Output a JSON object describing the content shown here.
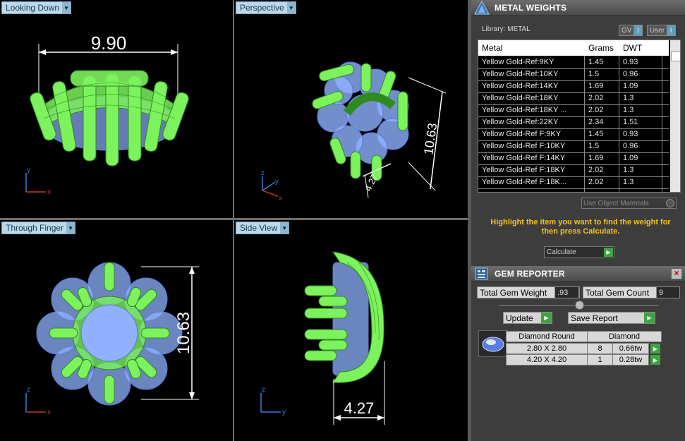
{
  "viewports": {
    "looking_down": {
      "label": "Looking Down",
      "dimension": "9.90",
      "axis_a": "y",
      "axis_b": "x"
    },
    "perspective": {
      "label": "Perspective",
      "dim_long": "10.63",
      "dim_short": "4.27",
      "axis_a": "z",
      "axis_b": "y",
      "axis_c": "x"
    },
    "through_finger": {
      "label": "Through Finger",
      "dimension": "10.63",
      "axis_a": "z",
      "axis_b": "x"
    },
    "side_view": {
      "label": "Side View",
      "dimension": "4.27",
      "axis_a": "z",
      "axis_b": "y"
    }
  },
  "metal_weights": {
    "title": "METAL WEIGHTS",
    "library": "Library: METAL",
    "toggle_gv": "GV",
    "toggle_user": "User",
    "columns": [
      "Metal",
      "Grams",
      "DWT"
    ],
    "rows": [
      [
        "Yellow Gold-Ref:9KY",
        "1.45",
        "0.93"
      ],
      [
        "Yellow Gold-Ref:10KY",
        "1.5",
        "0.96"
      ],
      [
        "Yellow Gold-Ref:14KY",
        "1.69",
        "1.09"
      ],
      [
        "Yellow Gold-Ref:18KY",
        "2.02",
        "1.3"
      ],
      [
        "Yellow Gold-Ref:18KY ...",
        "2.02",
        "1.3"
      ],
      [
        "Yellow Gold-Ref:22KY",
        "2.34",
        "1.51"
      ],
      [
        "Yellow Gold-Ref F:9KY",
        "1.45",
        "0.93"
      ],
      [
        "Yellow Gold-Ref F:10KY",
        "1.5",
        "0.96"
      ],
      [
        "Yellow Gold-Ref F:14KY",
        "1.69",
        "1.09"
      ],
      [
        "Yellow Gold-Ref F:18KY",
        "2.02",
        "1.3"
      ],
      [
        "Yellow Gold-Ref F:18K...",
        "2.02",
        "1.3"
      ]
    ],
    "use_object_materials": "Use Object Materials",
    "hint": "Highlight the item you want to find the weight for then press Calculate.",
    "calculate": "Calculate"
  },
  "gem_reporter": {
    "title": "GEM REPORTER",
    "total_weight_label": "Total Gem Weight",
    "total_weight_value": ".93",
    "total_count_label": "Total Gem Count",
    "total_count_value": "9",
    "update": "Update",
    "save_report": "Save Report",
    "group_header": [
      "Diamond Round",
      "Diamond"
    ],
    "gems": [
      {
        "size": "2.80 X 2.80",
        "count": "8",
        "weight": "0.66tw"
      },
      {
        "size": "4.20 X 4.20",
        "count": "1",
        "weight": "0.28tw"
      }
    ]
  },
  "colors": {
    "wire_green": "#7cf25c",
    "gem_blue": "#8fb1ff",
    "hint_yellow": "#f4c21b",
    "button_green": "#3fa33f"
  }
}
